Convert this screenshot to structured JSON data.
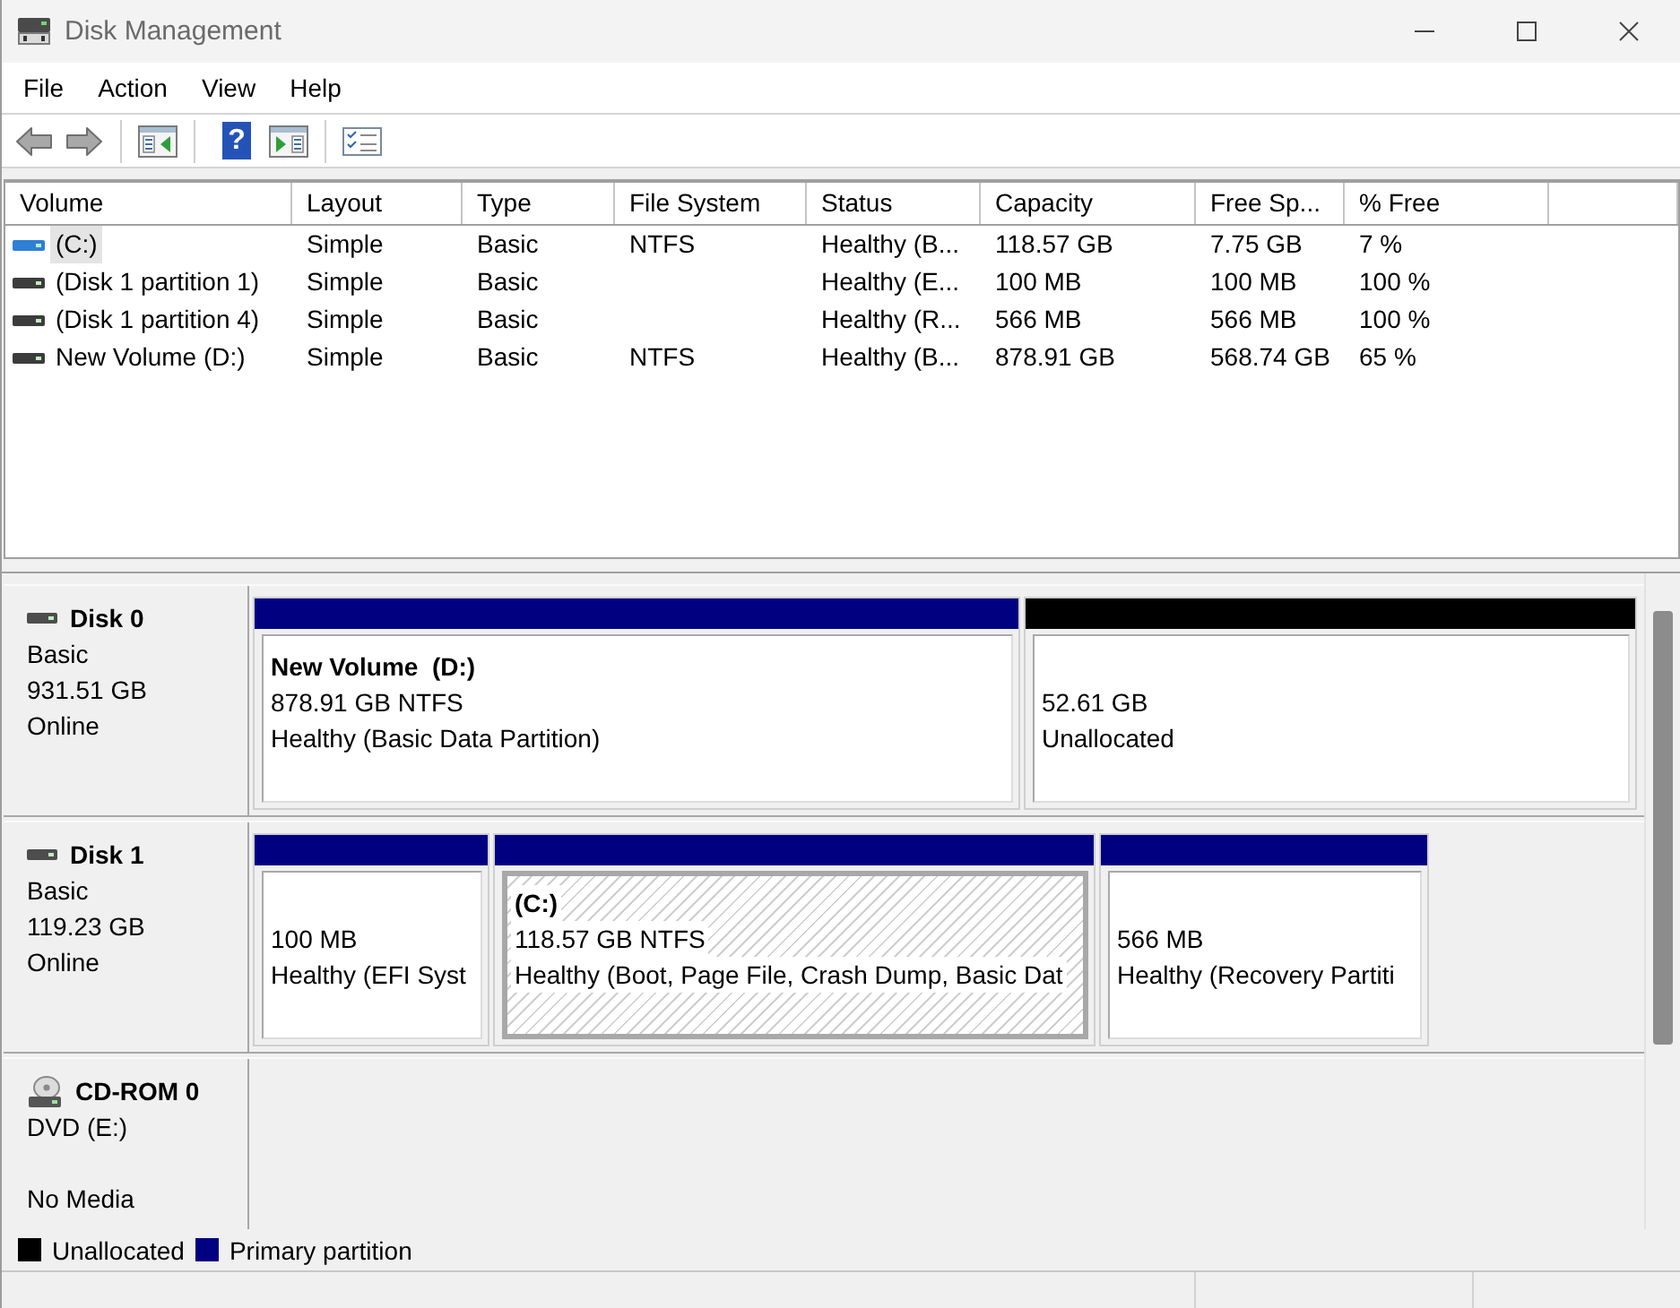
{
  "window": {
    "title": "Disk Management"
  },
  "menu": [
    {
      "label": "File"
    },
    {
      "label": "Action"
    },
    {
      "label": "View"
    },
    {
      "label": "Help"
    }
  ],
  "toolbar": {
    "help_glyph": "?"
  },
  "volume_list": {
    "columns": [
      "Volume",
      "Layout",
      "Type",
      "File System",
      "Status",
      "Capacity",
      "Free Sp...",
      "% Free"
    ],
    "rows": [
      {
        "volume": "(C:)",
        "layout": "Simple",
        "type": "Basic",
        "file_system": "NTFS",
        "status": "Healthy (B...",
        "capacity": "118.57 GB",
        "free_space": "7.75 GB",
        "percent_free": "7 %",
        "color": "#2e7fd6",
        "selected": true
      },
      {
        "volume": "(Disk 1 partition 1)",
        "layout": "Simple",
        "type": "Basic",
        "status": "Healthy (E...",
        "capacity": "100 MB",
        "free_space": "100 MB",
        "percent_free": "100 %",
        "color": "#3c3c3c",
        "selected": false
      },
      {
        "volume": "(Disk 1 partition 4)",
        "layout": "Simple",
        "type": "Basic",
        "status": "Healthy (R...",
        "capacity": "566 MB",
        "free_space": "566 MB",
        "percent_free": "100 %",
        "color": "#3c3c3c",
        "selected": false
      },
      {
        "volume": "New Volume (D:)",
        "layout": "Simple",
        "type": "Basic",
        "file_system": "NTFS",
        "status": "Healthy (B...",
        "capacity": "878.91 GB",
        "free_space": "568.74 GB",
        "percent_free": "65 %",
        "color": "#3c3c3c",
        "selected": false
      }
    ]
  },
  "disks": [
    {
      "kind": "disk",
      "name": "Disk 0",
      "type": "Basic",
      "size": "931.51 GB",
      "status": "Online",
      "partitions": [
        {
          "kind": "primary",
          "name": "New Volume  (D:)",
          "size": "878.91 GB NTFS",
          "status": "Healthy (Basic Data Partition)",
          "selected": false
        },
        {
          "kind": "unallocated",
          "size": "52.61 GB",
          "status": "Unallocated",
          "selected": false
        }
      ]
    },
    {
      "kind": "disk",
      "name": "Disk 1",
      "type": "Basic",
      "size": "119.23 GB",
      "status": "Online",
      "partitions": [
        {
          "kind": "primary",
          "size": "100 MB",
          "status": "Healthy (EFI Syst",
          "selected": false
        },
        {
          "kind": "primary",
          "name": "(C:)",
          "size": "118.57 GB NTFS",
          "status": "Healthy (Boot, Page File, Crash Dump, Basic Dat",
          "selected": true
        },
        {
          "kind": "primary",
          "size": "566 MB",
          "status": "Healthy (Recovery Partiti",
          "selected": false
        }
      ]
    },
    {
      "kind": "cdrom",
      "name": "CD-ROM 0",
      "type": "DVD (E:)",
      "status": "No Media"
    }
  ],
  "legend": [
    {
      "label": "Unallocated",
      "color": "#000000"
    },
    {
      "label": "Primary partition",
      "color": "#000080"
    }
  ]
}
